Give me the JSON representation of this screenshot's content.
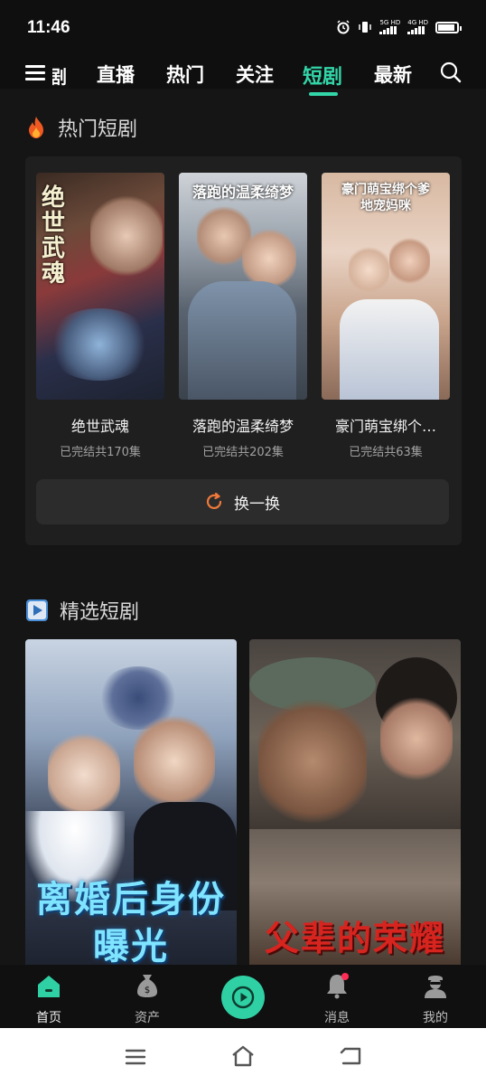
{
  "status_bar": {
    "time": "11:46",
    "net1": "5G HD",
    "net2": "4G HD"
  },
  "top_nav": {
    "partial_tab": "剧",
    "tabs": [
      {
        "label": "直播",
        "active": false
      },
      {
        "label": "热门",
        "active": false
      },
      {
        "label": "关注",
        "active": false
      },
      {
        "label": "短剧",
        "active": true
      },
      {
        "label": "最新",
        "active": false
      }
    ],
    "accent": "#33d6a9"
  },
  "hot_section": {
    "title": "热门短剧",
    "icon": "fire-icon",
    "dramas": [
      {
        "title": "绝世武魂",
        "status": "已完结共170集",
        "poster_text": "绝世武魂"
      },
      {
        "title": "落跑的温柔绮梦",
        "status": "已完结共202集",
        "poster_text": "落跑的温柔绮梦"
      },
      {
        "title": "豪门萌宝绑个…",
        "status": "已完结共63集",
        "poster_text": "豪门萌宝绑个爹地宠妈咪"
      }
    ],
    "refresh_label": "换一换",
    "refresh_color": "#f0793a"
  },
  "featured_section": {
    "title": "精选短剧",
    "icon": "play-square-icon",
    "items": [
      {
        "poster_text": "离婚后身份曝光"
      },
      {
        "poster_text": "父辈的荣耀"
      }
    ]
  },
  "bottom_nav": {
    "items": [
      {
        "label": "首页",
        "icon": "home-icon",
        "active": true
      },
      {
        "label": "资产",
        "icon": "money-bag-icon",
        "active": false
      },
      {
        "label": "",
        "icon": "play-circle-icon",
        "active": false
      },
      {
        "label": "消息",
        "icon": "bell-icon",
        "active": false
      },
      {
        "label": "我的",
        "icon": "user-icon",
        "active": false
      }
    ]
  }
}
